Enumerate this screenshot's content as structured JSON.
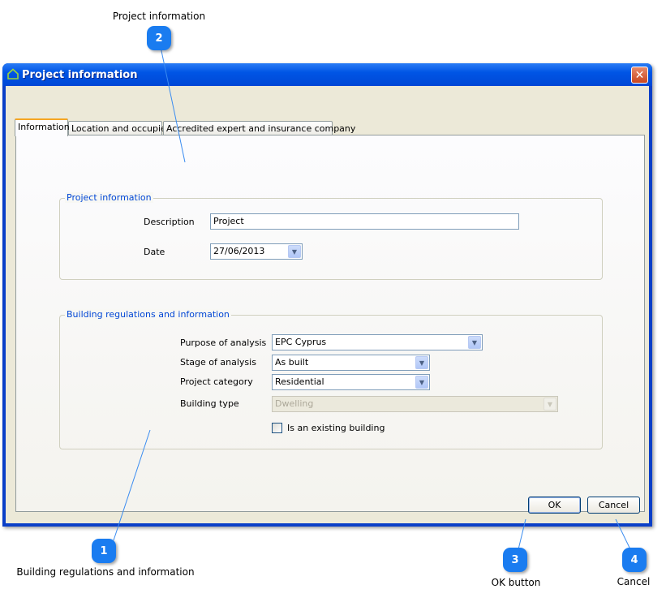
{
  "callouts": [
    {
      "number": "1",
      "label": "Building regulations and information"
    },
    {
      "number": "2",
      "label": "Project information"
    },
    {
      "number": "3",
      "label": "OK button"
    },
    {
      "number": "4",
      "label": "Cancel"
    }
  ],
  "window": {
    "title": "Project information",
    "icon": "home-icon",
    "close_icon": "close-icon"
  },
  "tabs": [
    {
      "label": "Information",
      "active": true
    },
    {
      "label": "Location and occupier",
      "active": false
    },
    {
      "label": "Accredited expert and insurance company",
      "active": false
    }
  ],
  "project_info": {
    "legend": "Project information",
    "description_label": "Description",
    "description_value": "Project",
    "date_label": "Date",
    "date_value": "27/06/2013"
  },
  "building": {
    "legend": "Building regulations and information",
    "purpose_label": "Purpose of analysis",
    "purpose_value": "EPC Cyprus",
    "stage_label": "Stage of analysis",
    "stage_value": "As built",
    "category_label": "Project category",
    "category_value": "Residential",
    "type_label": "Building type",
    "type_value": "Dwelling",
    "existing_label": "Is an existing building",
    "existing_checked": false
  },
  "buttons": {
    "ok": "OK",
    "cancel": "Cancel"
  },
  "colors": {
    "callout": "#1a7cf0",
    "title_bar": "#0055e5",
    "legend": "#0046d5"
  }
}
